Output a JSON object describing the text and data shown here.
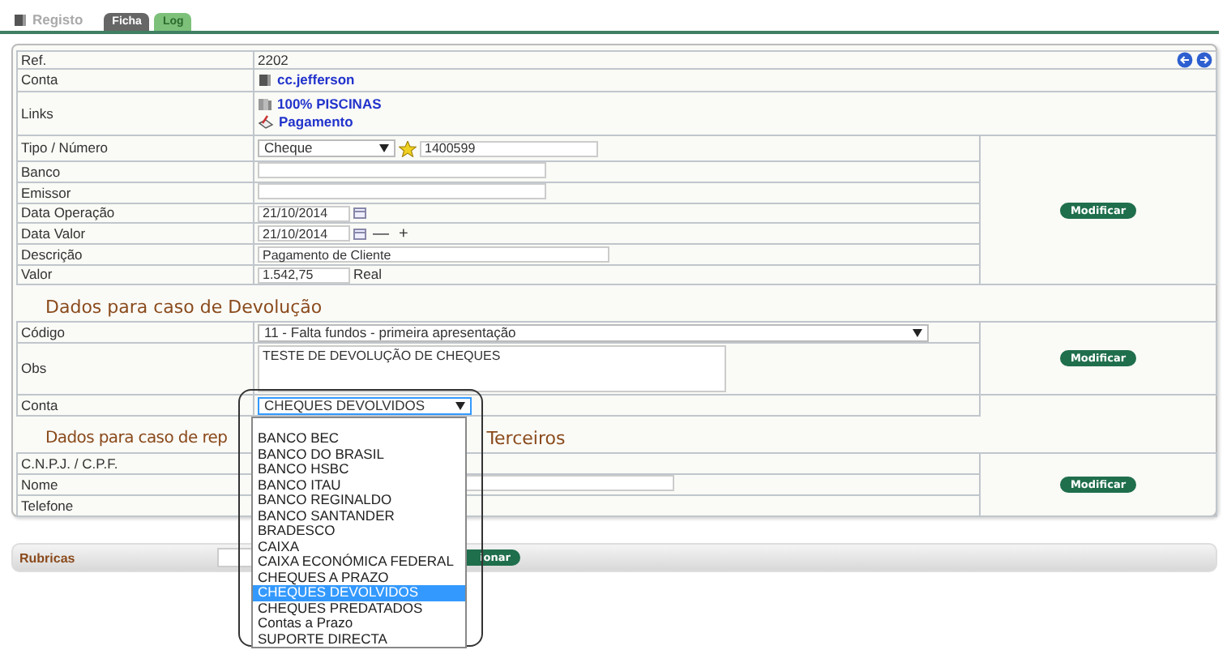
{
  "tabs": [
    {
      "label": "Registo",
      "selected": false,
      "kind": "title"
    },
    {
      "label": "Ficha",
      "selected": true,
      "kind": "tab"
    },
    {
      "label": "Log",
      "selected": false,
      "kind": "tab"
    }
  ],
  "record": {
    "rows": [
      {
        "label": "Ref.",
        "kind": "text",
        "value": "2202"
      },
      {
        "label": "Conta",
        "kind": "links",
        "links": [
          "cc.jefferson"
        ]
      },
      {
        "label": "Links",
        "kind": "links",
        "links": [
          "100% PISCINAS",
          "Pagamento"
        ]
      },
      {
        "label": "Tipo / Número",
        "kind": "select_number",
        "select": "Cheque",
        "number": "1400599"
      },
      {
        "label": "Banco",
        "kind": "input"
      },
      {
        "label": "Emissor",
        "kind": "input"
      },
      {
        "label": "Data Operação",
        "kind": "date",
        "value": "21/10/2014"
      },
      {
        "label": "Data Valor",
        "kind": "date",
        "value": "21/10/2014",
        "adjust": [
          "—",
          "+"
        ]
      },
      {
        "label": "Descrição",
        "kind": "input",
        "value": "Pagamento de Cliente"
      },
      {
        "label": "Valor",
        "kind": "input_unit",
        "value": "1.542,75",
        "unit": "Real"
      }
    ],
    "action": "Modificar"
  },
  "devolucao": {
    "heading": "Dados para caso de Devolução",
    "rows": [
      {
        "label": "Código",
        "kind": "select",
        "value": "11 - Falta fundos - primeira apresentação"
      },
      {
        "label": "Obs",
        "kind": "textarea",
        "value": "TESTE DE DEVOLUÇÃO DE CHEQUES"
      },
      {
        "label": "Conta",
        "kind": "select",
        "value": "CHEQUES DEVOLVIDOS",
        "open": true
      }
    ],
    "action": "Modificar",
    "options": [
      {
        "label": "BANCO BEC",
        "selected": false
      },
      {
        "label": "BANCO DO BRASIL",
        "selected": false
      },
      {
        "label": "BANCO HSBC",
        "selected": false
      },
      {
        "label": "BANCO ITAU",
        "selected": false
      },
      {
        "label": "BANCO REGINALDO",
        "selected": false
      },
      {
        "label": "BANCO SANTANDER",
        "selected": false
      },
      {
        "label": "BRADESCO",
        "selected": false
      },
      {
        "label": "CAIXA",
        "selected": false
      },
      {
        "label": "CAIXA ECONÓMICA FEDERAL",
        "selected": false
      },
      {
        "label": "CHEQUES A PRAZO",
        "selected": false
      },
      {
        "label": "CHEQUES DEVOLVIDOS",
        "selected": true
      },
      {
        "label": "CHEQUES PREDATADOS",
        "selected": false
      },
      {
        "label": "Contas a Prazo",
        "selected": false
      },
      {
        "label": "SUPORTE DIRECTA",
        "selected": false
      }
    ]
  },
  "terceiros": {
    "heading": [
      "Dados para caso de rep",
      "Terceiros"
    ],
    "rows": [
      {
        "label": "C.N.P.J. / C.P.F.",
        "kind": "text"
      },
      {
        "label": "Nome",
        "kind": "input"
      },
      {
        "label": "Telefone",
        "kind": "text"
      }
    ],
    "action": "Modificar"
  },
  "rubricas": {
    "label": "Rubricas",
    "button": "ionar"
  }
}
